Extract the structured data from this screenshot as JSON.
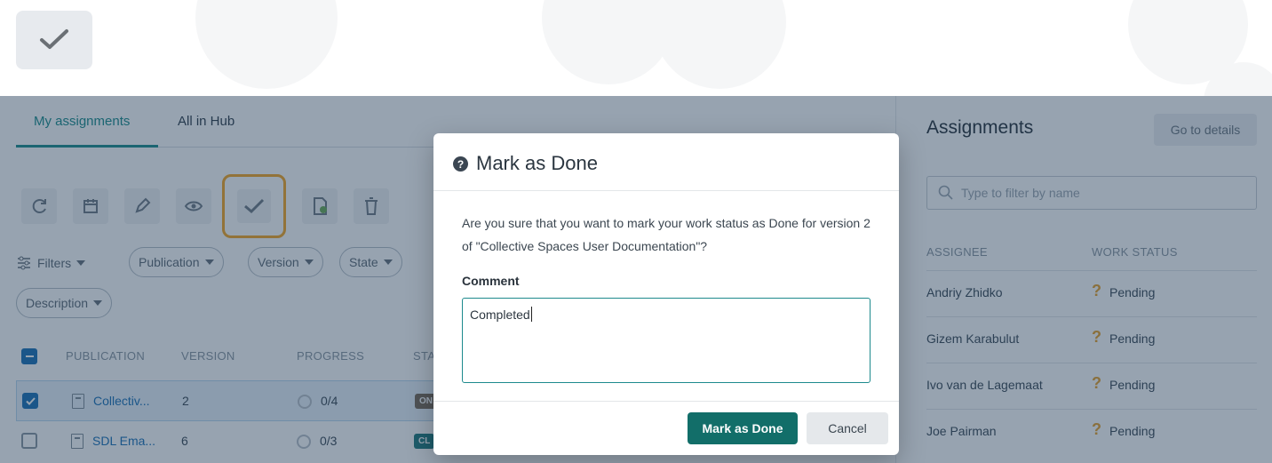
{
  "callout": {
    "icon": "check-icon"
  },
  "tabs": [
    {
      "label": "My assignments",
      "active": true
    },
    {
      "label": "All in Hub",
      "active": false
    }
  ],
  "toolbar": {
    "icons": [
      "refresh-icon",
      "calendar-icon",
      "edit-icon",
      "view-icon",
      "check-icon",
      "document-check-icon",
      "delete-icon"
    ],
    "highlighted": "check-icon"
  },
  "filters": {
    "label": "Filters",
    "chips": [
      "Publication",
      "Version",
      "State",
      "Description"
    ]
  },
  "table": {
    "headers": [
      "PUBLICATION",
      "VERSION",
      "PROGRESS",
      "STA"
    ],
    "rows": [
      {
        "selected": true,
        "publication": "Collectiv...",
        "version": "2",
        "progress": "0/4",
        "status": "ON",
        "status_color": "#7b6a58"
      },
      {
        "selected": false,
        "publication": "SDL Ema...",
        "version": "6",
        "progress": "0/3",
        "status": "CL",
        "status_color": "#1f7a7f"
      }
    ]
  },
  "panel": {
    "title": "Assignments",
    "details_button": "Go to details",
    "filter_placeholder": "Type to filter by name",
    "headers": [
      "ASSIGNEE",
      "WORK STATUS"
    ],
    "rows": [
      {
        "assignee": "Andriy Zhidko",
        "status_icon": "?",
        "status": "Pending"
      },
      {
        "assignee": "Gizem Karabulut",
        "status_icon": "?",
        "status": "Pending"
      },
      {
        "assignee": "Ivo van de Lagemaat",
        "status_icon": "?",
        "status": "Pending"
      },
      {
        "assignee": "Joe Pairman",
        "status_icon": "?",
        "status": "Pending"
      }
    ]
  },
  "modal": {
    "title": "Mark as Done",
    "message": "Are you sure that you want to mark your work status as Done for version 2 of \"Collective Spaces User Documentation\"?",
    "comment_label": "Comment",
    "comment_value": "Completed",
    "primary_button": "Mark as Done",
    "secondary_button": "Cancel"
  },
  "colors": {
    "accent": "#1a8c8c",
    "primary_button": "#126e69",
    "highlight": "#f5a623",
    "pending": "#e8a12b"
  }
}
